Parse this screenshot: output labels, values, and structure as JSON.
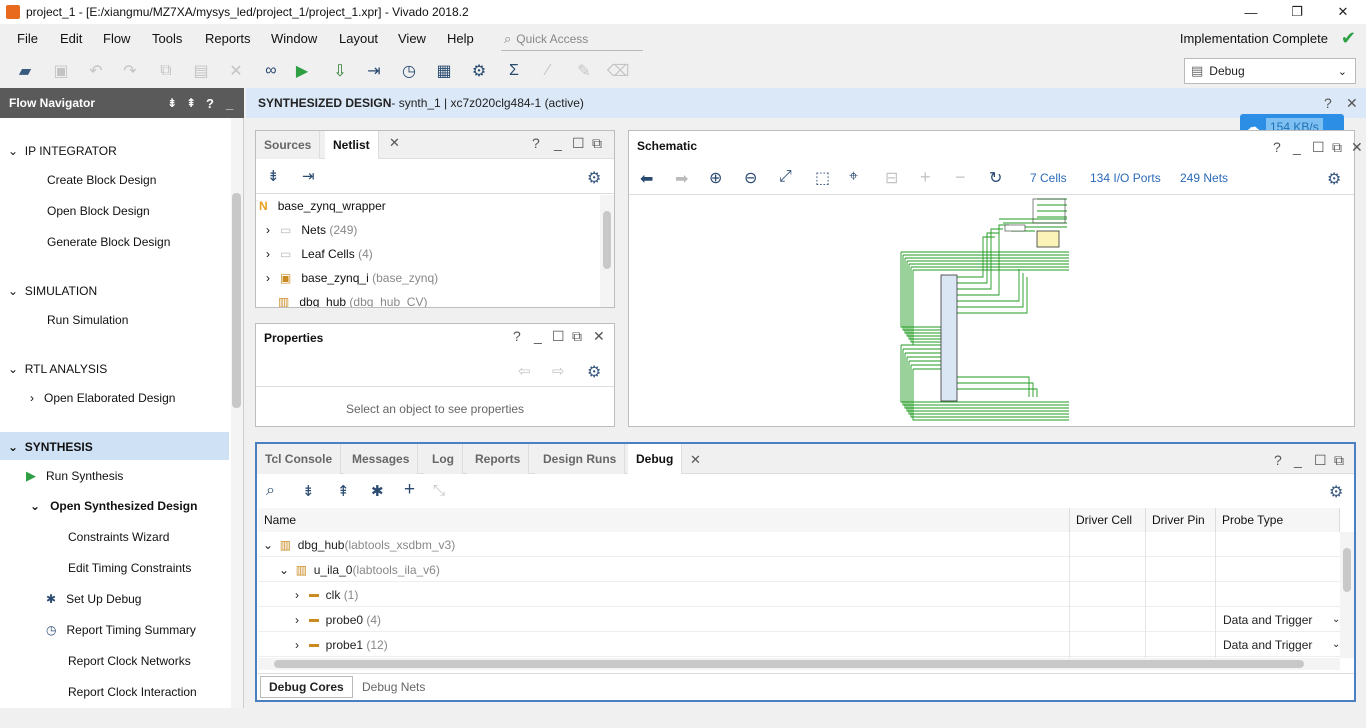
{
  "window": {
    "title": "project_1 - [E:/xiangmu/MZ7XA/mysys_led/project_1/project_1.xpr] - Vivado 2018.2",
    "controls": [
      "—",
      "❐",
      "✕"
    ]
  },
  "menu": [
    "File",
    "Edit",
    "Flow",
    "Tools",
    "Reports",
    "Window",
    "Layout",
    "View",
    "Help"
  ],
  "quick_access": {
    "placeholder": "Quick Access"
  },
  "status": {
    "text": "Implementation Complete",
    "color": "#2ea043"
  },
  "layout_select": {
    "value": "Debug"
  },
  "flow_navigator": {
    "title": "Flow Navigator",
    "sections": [
      {
        "label": "IP INTEGRATOR",
        "items": [
          "Create Block Design",
          "Open Block Design",
          "Generate Block Design"
        ]
      },
      {
        "label": "SIMULATION",
        "items": [
          "Run Simulation"
        ]
      },
      {
        "label": "RTL ANALYSIS",
        "items": [
          "Open Elaborated Design"
        ]
      },
      {
        "label": "SYNTHESIS",
        "items": [
          "Run Synthesis",
          "Open Synthesized Design",
          "Constraints Wizard",
          "Edit Timing Constraints",
          "Set Up Debug",
          "Report Timing Summary",
          "Report Clock Networks",
          "Report Clock Interaction"
        ]
      }
    ]
  },
  "design_header": {
    "title": "SYNTHESIZED DESIGN",
    "detail": " - synth_1 | xc7z020clg484-1  (active)"
  },
  "net_speed": "154 KB/s",
  "netlist_panel": {
    "tabs": [
      "Sources",
      "Netlist"
    ],
    "root": "base_zynq_wrapper",
    "rows": [
      {
        "label": "Nets",
        "count": "(249)"
      },
      {
        "label": "Leaf Cells",
        "count": "(4)"
      },
      {
        "label": "base_zynq_i",
        "count": "(base_zynq)"
      },
      {
        "label": "dbg_hub",
        "count": "(dbg_hub_CV)"
      }
    ]
  },
  "properties_panel": {
    "title": "Properties",
    "empty": "Select an object to see properties"
  },
  "schematic_panel": {
    "title": "Schematic",
    "cells": "7 Cells",
    "ports": "134 I/O Ports",
    "nets": "249 Nets"
  },
  "bottom_panel": {
    "tabs": [
      "Tcl Console",
      "Messages",
      "Log",
      "Reports",
      "Design Runs",
      "Debug"
    ],
    "columns": [
      "Name",
      "Driver Cell",
      "Driver Pin",
      "Probe Type"
    ],
    "rows": [
      {
        "name": "dbg_hub",
        "sub": "(labtools_xsdbm_v3)",
        "probe": ""
      },
      {
        "name": "u_ila_0",
        "sub": "(labtools_ila_v6)",
        "probe": ""
      },
      {
        "name": "clk",
        "sub": "(1)",
        "probe": ""
      },
      {
        "name": "probe0",
        "sub": "(4)",
        "probe": "Data and Trigger"
      },
      {
        "name": "probe1",
        "sub": "(12)",
        "probe": "Data and Trigger"
      }
    ],
    "bottom_tabs": [
      "Debug Cores",
      "Debug Nets"
    ]
  }
}
